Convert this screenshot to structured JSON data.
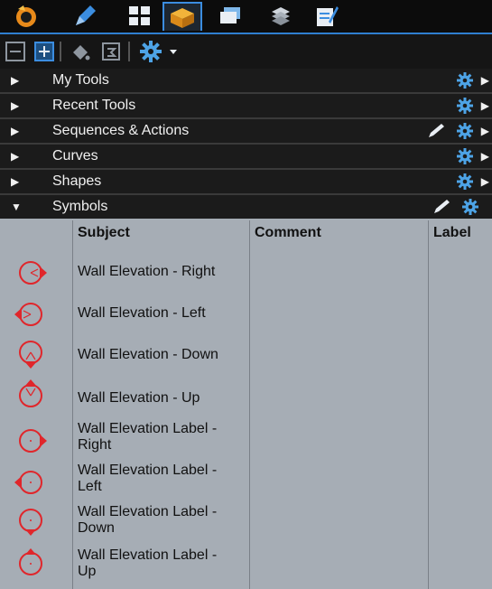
{
  "tabs": [
    {
      "name": "tab-logo",
      "icon": "app-logo-icon"
    },
    {
      "name": "tab-markup",
      "icon": "pen-icon"
    },
    {
      "name": "tab-thumbnails",
      "icon": "grid-icon"
    },
    {
      "name": "tab-toolchest",
      "icon": "toolbox-icon"
    },
    {
      "name": "tab-layers",
      "icon": "layers-icon"
    },
    {
      "name": "tab-stack",
      "icon": "stack-icon"
    },
    {
      "name": "tab-properties",
      "icon": "notepad-icon"
    }
  ],
  "toolbar": {
    "icons": [
      "collapse-all-icon",
      "expand-all-icon",
      "bucket-icon",
      "find-icon",
      "settings-gear-icon",
      "dropdown-arrow-icon"
    ]
  },
  "sections": [
    {
      "label": "My Tools",
      "expanded": false,
      "pen": false
    },
    {
      "label": "Recent Tools",
      "expanded": false,
      "pen": false
    },
    {
      "label": "Sequences & Actions",
      "expanded": false,
      "pen": true
    },
    {
      "label": "Curves",
      "expanded": false,
      "pen": false
    },
    {
      "label": "Shapes",
      "expanded": false,
      "pen": false
    },
    {
      "label": "Symbols",
      "expanded": true,
      "pen": true
    }
  ],
  "table": {
    "headers": {
      "subject": "Subject",
      "comment": "Comment",
      "label": "Label"
    },
    "rows": [
      {
        "subject": "Wall Elevation - Right",
        "symbol": "wall-elevation-right-icon"
      },
      {
        "subject": "Wall Elevation - Left",
        "symbol": "wall-elevation-left-icon"
      },
      {
        "subject": "Wall Elevation - Down",
        "symbol": "wall-elevation-down-icon"
      },
      {
        "subject": "Wall Elevation - Up",
        "symbol": "wall-elevation-up-icon"
      },
      {
        "subject": "Wall Elevation Label - Right",
        "symbol": "wall-elevation-label-right-icon"
      },
      {
        "subject": "Wall Elevation Label - Left",
        "symbol": "wall-elevation-label-left-icon"
      },
      {
        "subject": "Wall Elevation Label - Down",
        "symbol": "wall-elevation-label-down-icon"
      },
      {
        "subject": "Wall Elevation Label - Up",
        "symbol": "wall-elevation-label-up-icon"
      }
    ]
  },
  "colors": {
    "accent": "#2f7fd0",
    "symbol_red": "#e0262b",
    "panel_bg": "#a6adb5",
    "header_bg": "#1b1b1b",
    "gear": "#4da3e6"
  }
}
